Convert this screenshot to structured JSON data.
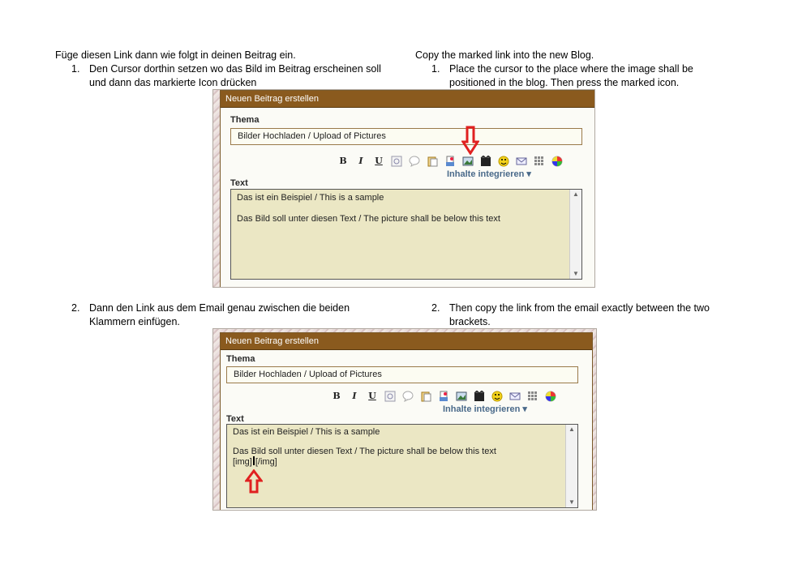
{
  "instructions": {
    "de_intro": "Füge diesen Link dann wie folgt in deinen Beitrag ein.",
    "en_intro": "Copy the marked link into the new Blog.",
    "step1_de_num": "1.",
    "step1_de_line1": "Den Cursor dorthin setzen wo das Bild im Beitrag erscheinen soll",
    "step1_de_line2": "und dann das markierte Icon drücken",
    "step1_en_num": "1.",
    "step1_en_line1": "Place the cursor to the place where the image shall be",
    "step1_en_line2": "positioned in the blog. Then press the marked icon.",
    "step2_de_num": "2.",
    "step2_de_line1": "Dann den Link aus dem Email genau zwischen die beiden",
    "step2_de_line2": "Klammern einfügen.",
    "step2_en_num": "2.",
    "step2_en_line1": "Then copy the link from the email exactly between the two",
    "step2_en_line2": "brackets."
  },
  "form": {
    "header": "Neuen Beitrag erstellen",
    "subject_label": "Thema",
    "subject_value": "Bilder Hochladen / Upload of Pictures",
    "text_label": "Text",
    "insert_menu": "Inhalte integrieren ▾",
    "toolbar": {
      "bold": "B",
      "italic": "I",
      "underline": "U"
    },
    "body_line1": "Das ist ein Beispiel / This is a sample",
    "body_line2": "Das Bild soll unter diesen Text / The picture shall be below this text",
    "img_open": "[img]",
    "img_close": "[/img]"
  },
  "colors": {
    "header_brown": "#8a5a1e",
    "textarea_bg": "#ebe7c4",
    "marker_red": "#e02020",
    "menu_blue": "#4a6a8a"
  },
  "icons": [
    "bold-icon",
    "italic-icon",
    "underline-icon",
    "quote-icon",
    "speech-bubble-icon",
    "paste-icon",
    "upload-icon",
    "image-icon",
    "video-icon",
    "smiley-icon",
    "email-icon",
    "table-icon",
    "color-wheel-icon"
  ]
}
